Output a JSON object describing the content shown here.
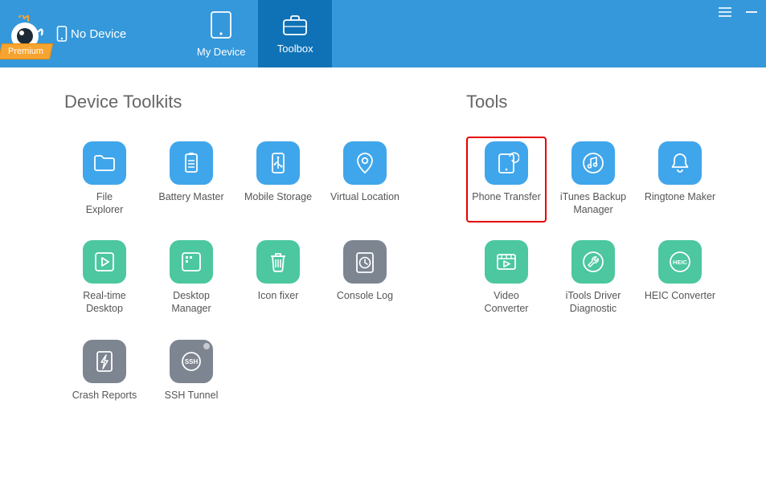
{
  "header": {
    "premium": "Premium",
    "device_status": "No Device",
    "tabs": {
      "my_device": "My Device",
      "toolbox": "Toolbox"
    }
  },
  "sections": {
    "device_toolkits": {
      "title": "Device Toolkits",
      "items": [
        {
          "id": "file-explorer",
          "label": "File\nExplorer",
          "icon": "folder",
          "color": "blue"
        },
        {
          "id": "battery-master",
          "label": "Battery Master",
          "icon": "battery",
          "color": "blue"
        },
        {
          "id": "mobile-storage",
          "label": "Mobile Storage",
          "icon": "usb",
          "color": "blue"
        },
        {
          "id": "virtual-location",
          "label": "Virtual Location",
          "icon": "location",
          "color": "blue"
        },
        {
          "id": "realtime-desktop",
          "label": "Real-time\nDesktop",
          "icon": "play",
          "color": "green"
        },
        {
          "id": "desktop-manager",
          "label": "Desktop\nManager",
          "icon": "grid",
          "color": "green"
        },
        {
          "id": "icon-fixer",
          "label": "Icon fixer",
          "icon": "trash",
          "color": "green"
        },
        {
          "id": "console-log",
          "label": "Console Log",
          "icon": "clock",
          "color": "gray"
        },
        {
          "id": "crash-reports",
          "label": "Crash Reports",
          "icon": "bolt",
          "color": "gray"
        },
        {
          "id": "ssh-tunnel",
          "label": "SSH Tunnel",
          "icon": "ssh",
          "color": "gray"
        }
      ]
    },
    "tools": {
      "title": "Tools",
      "items": [
        {
          "id": "phone-transfer",
          "label": "Phone Transfer",
          "icon": "transfer",
          "color": "blue",
          "highlight": true
        },
        {
          "id": "itunes-backup-manager",
          "label": "iTunes Backup\nManager",
          "icon": "music",
          "color": "blue"
        },
        {
          "id": "ringtone-maker",
          "label": "Ringtone Maker",
          "icon": "bell",
          "color": "blue"
        },
        {
          "id": "video-converter",
          "label": "Video\nConverter",
          "icon": "film",
          "color": "green"
        },
        {
          "id": "itools-driver-diagnostic",
          "label": "iTools Driver\nDiagnostic",
          "icon": "wrench",
          "color": "green"
        },
        {
          "id": "heic-converter",
          "label": "HEIC Converter",
          "icon": "heic",
          "color": "green"
        }
      ]
    }
  }
}
